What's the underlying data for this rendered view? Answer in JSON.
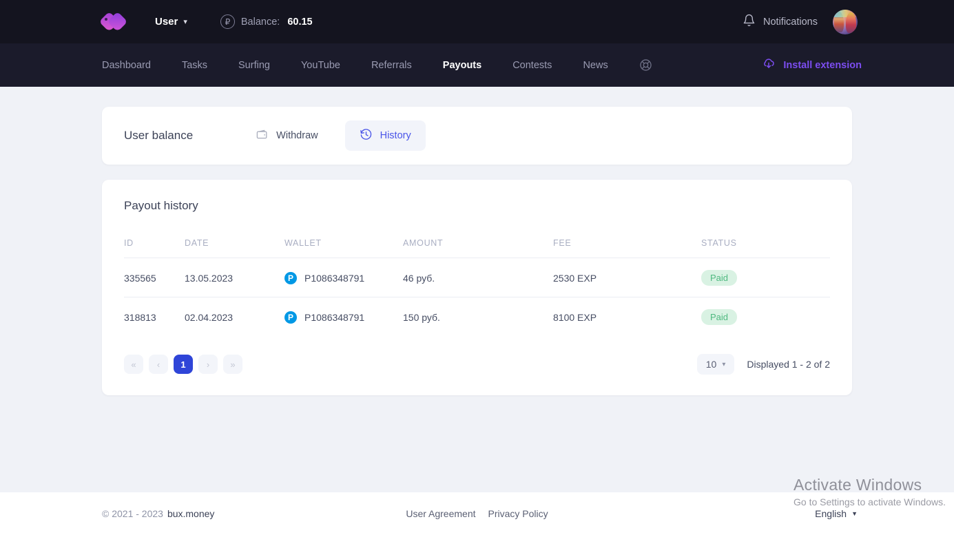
{
  "header": {
    "logo_icon": "bux-logo-icon",
    "user_menu_label": "User",
    "user_menu_chevron": "chevron-down-icon",
    "balance_icon": "ruble-circle-icon",
    "balance_label": "Balance:",
    "balance_value": "60.15",
    "notifications_icon": "bell-icon",
    "notifications_label": "Notifications",
    "avatar_icon": "user-avatar"
  },
  "nav": {
    "items": [
      {
        "label": "Dashboard",
        "active": false
      },
      {
        "label": "Tasks",
        "active": false
      },
      {
        "label": "Surfing",
        "active": false
      },
      {
        "label": "YouTube",
        "active": false
      },
      {
        "label": "Referrals",
        "active": false
      },
      {
        "label": "Payouts",
        "active": true
      },
      {
        "label": "Contests",
        "active": false
      },
      {
        "label": "News",
        "active": false
      }
    ],
    "support_icon": "lifebuoy-icon",
    "install_icon": "cloud-download-icon",
    "install_label": "Install extension",
    "install_color": "#7c4df0"
  },
  "balance_card": {
    "title": "User balance",
    "withdraw_icon": "wallet-icon",
    "withdraw_label": "Withdraw",
    "history_icon": "clock-rewind-icon",
    "history_label": "History",
    "active_tab": "History"
  },
  "history_card": {
    "title": "Payout history",
    "columns": [
      "ID",
      "DATE",
      "WALLET",
      "AMOUNT",
      "FEE",
      "STATUS"
    ],
    "rows": [
      {
        "id": "335565",
        "date": "13.05.2023",
        "wallet_icon": "payeer-icon",
        "wallet": "P1086348791",
        "amount": "46 руб.",
        "fee": "2530 EXP",
        "status": "Paid"
      },
      {
        "id": "318813",
        "date": "02.04.2023",
        "wallet_icon": "payeer-icon",
        "wallet": "P1086348791",
        "amount": "150 руб.",
        "fee": "8100 EXP",
        "status": "Paid"
      }
    ],
    "status_badge_bg": "#d9f2e3",
    "status_badge_color": "#4fb980",
    "pagination": {
      "first_label": "«",
      "prev_label": "‹",
      "pages": [
        "1"
      ],
      "current_page": "1",
      "next_label": "›",
      "last_label": "»",
      "active_color": "#2f45d8"
    },
    "per_page_value": "10",
    "per_page_chevron": "chevron-down-icon",
    "displayed_text": "Displayed 1 - 2 of 2"
  },
  "footer": {
    "copyright": "© 2021 - 2023",
    "site_name": "bux.money",
    "links": [
      "User Agreement",
      "Privacy Policy"
    ],
    "language": "English",
    "language_caret": "caret-down-icon"
  },
  "watermark": {
    "line1": "Activate Windows",
    "line2": "Go to Settings to activate Windows."
  }
}
